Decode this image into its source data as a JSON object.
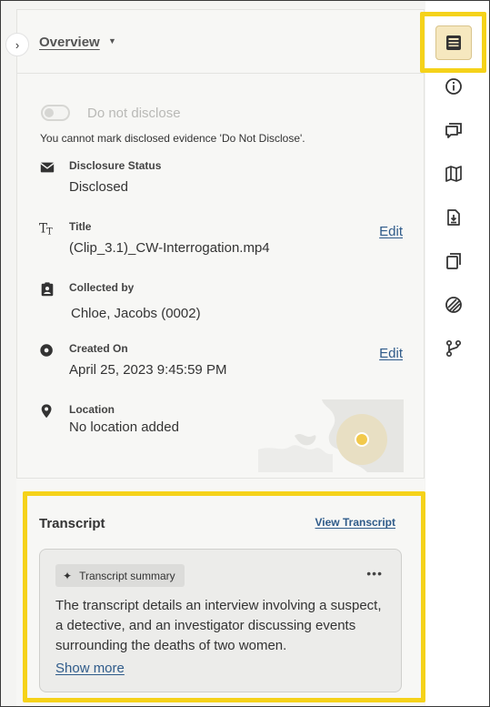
{
  "panel": {
    "header": {
      "title": "Overview",
      "caret_icon": "caret-down-icon",
      "collapse_icon": "chevron-right-icon"
    },
    "disclose_toggle": {
      "label": "Do not disclose",
      "enabled": false,
      "notice": "You cannot mark disclosed evidence 'Do Not Disclose'."
    },
    "fields": [
      {
        "label": "Disclosure Status",
        "value": "Disclosed",
        "icon": "envelope-icon",
        "edit": ""
      },
      {
        "label": "Title",
        "value": "(Clip_3.1)_CW-Interrogation.mp4",
        "icon": "text-size-icon",
        "edit": "Edit"
      },
      {
        "label": "Collected by",
        "value": "Chloe, Jacobs (0002)",
        "icon": "badge-clipboard-icon",
        "edit": ""
      },
      {
        "label": "Created On",
        "value": "April 25, 2023 9:45:59 PM",
        "icon": "record-circle-icon",
        "edit": "Edit"
      },
      {
        "label": "Location",
        "value": "No location added",
        "icon": "map-pin-icon",
        "edit": ""
      }
    ]
  },
  "transcript": {
    "title": "Transcript",
    "view_link": "View Transcript",
    "summary_chip": "Transcript summary",
    "summary_text": "The transcript details an interview involving a suspect, a detective, and an investigator discussing events surrounding the deaths of two women.",
    "show_more": "Show more",
    "more_icon": "more-horizontal-icon",
    "chip_icon": "sparkle-icon"
  },
  "rail": {
    "items": [
      {
        "name": "overview-icon",
        "active": true
      },
      {
        "name": "info-icon",
        "active": false
      },
      {
        "name": "comments-icon",
        "active": false
      },
      {
        "name": "map-icon",
        "active": false
      },
      {
        "name": "document-download-icon",
        "active": false
      },
      {
        "name": "copies-icon",
        "active": false
      },
      {
        "name": "redaction-icon",
        "active": false
      },
      {
        "name": "branch-icon",
        "active": false
      }
    ]
  },
  "colors": {
    "highlight": "#f5d21a",
    "link": "#2f5b8a",
    "map_marker": "#f2c94c"
  }
}
